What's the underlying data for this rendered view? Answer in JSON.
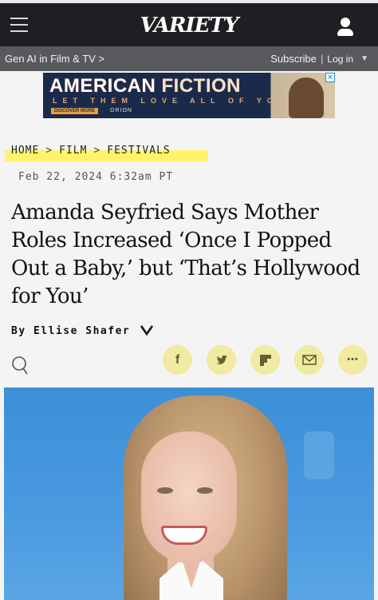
{
  "header": {
    "logo_text": "VARIETY",
    "menu_icon": "hamburger-menu-icon",
    "account_icon": "user-account-icon"
  },
  "subnav": {
    "left_link": "Gen AI in Film & TV >",
    "subscribe": "Subscribe",
    "separator": "|",
    "login": "Log in",
    "caret": "▼"
  },
  "ad": {
    "title_part1": "AMERICAN",
    "title_part2": "FICTION",
    "tagline": "LET THEM LOVE ALL OF YOU",
    "button": "DISCOVER MORE",
    "studio": "ORION",
    "close": "✕"
  },
  "breadcrumb": {
    "items": [
      "HOME",
      "FILM",
      "FESTIVALS"
    ],
    "separator": ">"
  },
  "article": {
    "date": "Feb 22, 2024 6:32am PT",
    "headline": "Amanda Seyfried Says Mother Roles Increased ‘Once I Popped Out a Baby,’ but ‘That’s Hollywood for You’",
    "byline": "By Ellise Shafer"
  },
  "share": {
    "facebook": "f",
    "more": "•••"
  },
  "colors": {
    "topbar": "#1e1f22",
    "subnav": "#57595c",
    "share_bg": "#f0eaa2",
    "highlight": "#fff36b"
  }
}
